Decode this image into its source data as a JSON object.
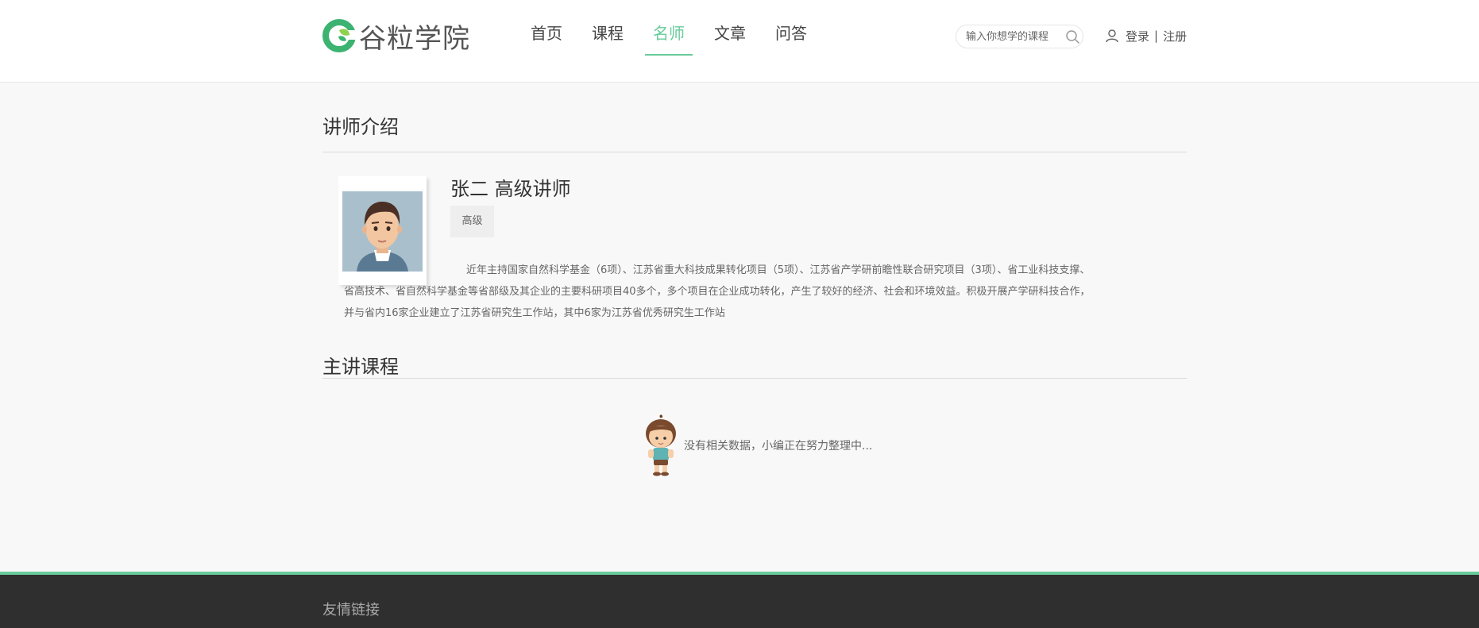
{
  "header": {
    "logo_text": "谷粒学院",
    "nav": [
      {
        "label": "首页",
        "active": false
      },
      {
        "label": "课程",
        "active": false
      },
      {
        "label": "名师",
        "active": true
      },
      {
        "label": "文章",
        "active": false
      },
      {
        "label": "问答",
        "active": false
      }
    ],
    "search": {
      "placeholder": "输入你想学的课程"
    },
    "login_label": "登录",
    "separator": "|",
    "register_label": "注册"
  },
  "teacher_section": {
    "title": "讲师介绍",
    "name_line": "张二  高级讲师",
    "level_badge": "高级",
    "intro": "近年主持国家自然科学基金（6项）、江苏省重大科技成果转化项目（5项）、江苏省产学研前瞻性联合研究项目（3项）、省工业科技支撑、省高技术、省自然科学基金等省部级及其企业的主要科研项目40多个，多个项目在企业成功转化，产生了较好的经济、社会和环境效益。积极开展产学研科技合作，并与省内16家企业建立了江苏省研究生工作站，其中6家为江苏省优秀研究生工作站"
  },
  "courses_section": {
    "title": "主讲课程",
    "empty_text": "没有相关数据，小编正在努力整理中..."
  },
  "footer": {
    "links_title": "友情链接"
  },
  "colors": {
    "accent": "#68cb9b",
    "footer_bg": "#2f2f2f",
    "page_bg": "#f8f8f8"
  },
  "icons": [
    "logo-icon",
    "search-icon",
    "user-icon",
    "avatar",
    "empty-kid-icon"
  ]
}
